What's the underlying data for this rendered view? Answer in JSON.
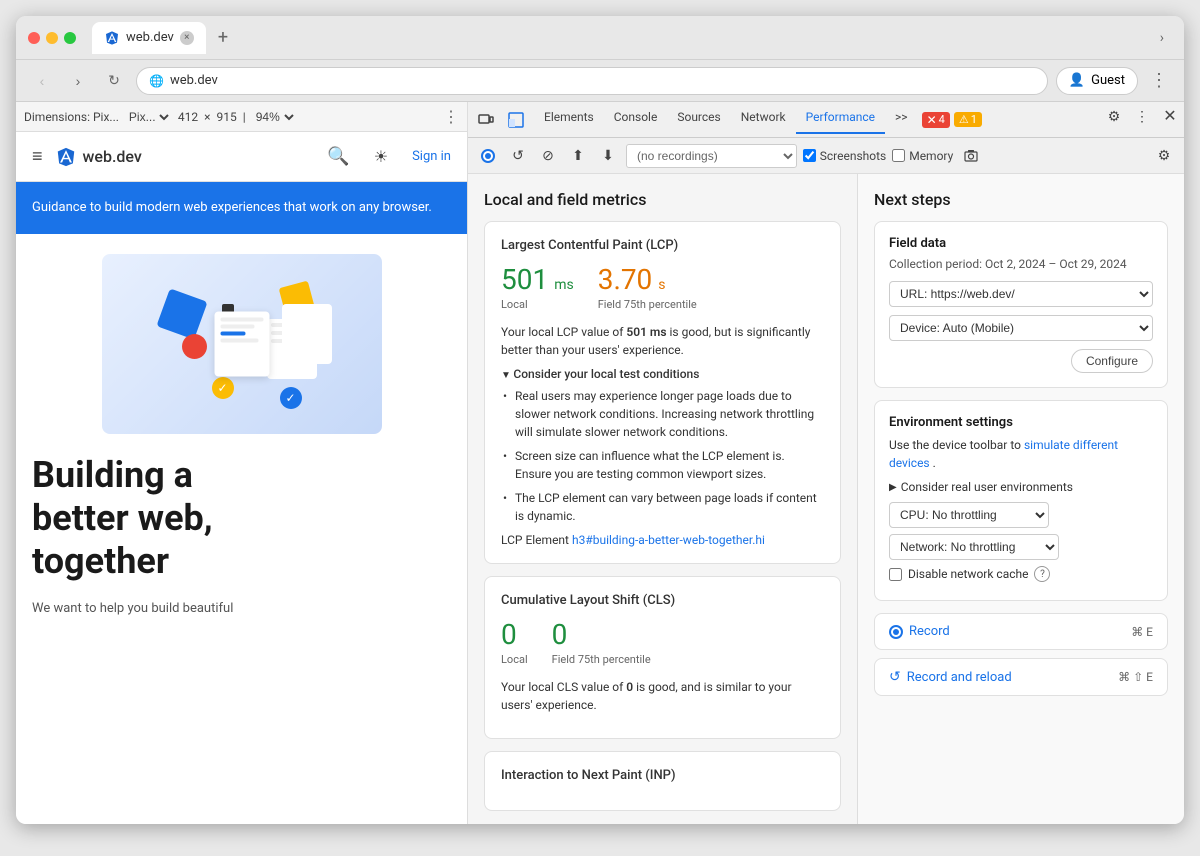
{
  "browser": {
    "tab_title": "web.dev",
    "tab_favicon": "🔷",
    "address": "web.dev",
    "new_tab_icon": "+",
    "chevron_icon": "›",
    "back_icon": "‹",
    "forward_icon": "›",
    "reload_icon": "↻",
    "profile_label": "Guest",
    "menu_icon": "⋮"
  },
  "dimensions_bar": {
    "device_label": "Dimensions: Pix...",
    "width": "412",
    "x_symbol": "×",
    "height": "915",
    "zoom": "94%",
    "separator": "|"
  },
  "devtools": {
    "tabs": [
      "Elements",
      "Console",
      "Sources",
      "Network",
      "Performance",
      ">>"
    ],
    "active_tab": "Performance",
    "error_count": "4",
    "warning_count": "1",
    "recording_placeholder": "(no recordings)",
    "screenshots_label": "Screenshots",
    "memory_label": "Memory",
    "record_controls": {
      "record_icon": "●",
      "reload_icon": "↺",
      "clear_icon": "⊘",
      "upload_icon": "⬆",
      "download_icon": "⬇"
    }
  },
  "website": {
    "menu_icon": "≡",
    "logo_text": "web.dev",
    "search_icon": "🔍",
    "theme_icon": "☀",
    "signin_label": "Sign in",
    "hero_text": "Guidance to build modern web experiences that work on any browser.",
    "headline_line1": "Building a",
    "headline_line2": "better web,",
    "headline_line3": "together",
    "subtext": "We want to help you build beautiful"
  },
  "performance": {
    "section_title": "Local and field metrics",
    "lcp": {
      "title": "Largest Contentful Paint (LCP)",
      "local_value": "501",
      "local_unit": "ms",
      "local_label": "Local",
      "field_value": "3.70",
      "field_unit": "s",
      "field_label": "Field 75th percentile",
      "description": "Your local LCP value of 501 ms is good, but is significantly better than your users' experience.",
      "collapsible_label": "Consider your local test conditions",
      "bullets": [
        "Real users may experience longer page loads due to slower network conditions. Increasing network throttling will simulate slower network conditions.",
        "Screen size can influence what the LCP element is. Ensure you are testing common viewport sizes.",
        "The LCP element can vary between page loads if content is dynamic."
      ],
      "element_label": "LCP Element",
      "element_link": "h3#building-a-better-web-together.hi"
    },
    "cls": {
      "title": "Cumulative Layout Shift (CLS)",
      "local_value": "0",
      "local_label": "Local",
      "field_value": "0",
      "field_label": "Field 75th percentile",
      "description_start": "Your local CLS value of",
      "description_value": "0",
      "description_end": "is good, and is similar to your users' experience."
    },
    "inp": {
      "title": "Interaction to Next Paint (INP)"
    }
  },
  "next_steps": {
    "title": "Next steps",
    "field_data": {
      "title": "Field data",
      "subtitle": "Collection period: Oct 2, 2024 – Oct 29, 2024",
      "url_label": "URL: https://web.dev/",
      "device_label": "Device: Auto (Mobile)",
      "configure_label": "Configure"
    },
    "environment": {
      "title": "Environment settings",
      "description": "Use the device toolbar to",
      "link_text": "simulate different devices",
      "link_suffix": ".",
      "collapsible": "Consider real user environments",
      "cpu_label": "CPU: No throttling",
      "network_label": "Network: No throttling",
      "disable_cache": "Disable network cache"
    },
    "record": {
      "label": "Record",
      "shortcut": "⌘ E"
    },
    "record_reload": {
      "label": "Record and reload",
      "shortcut": "⌘ ⇧ E"
    }
  }
}
